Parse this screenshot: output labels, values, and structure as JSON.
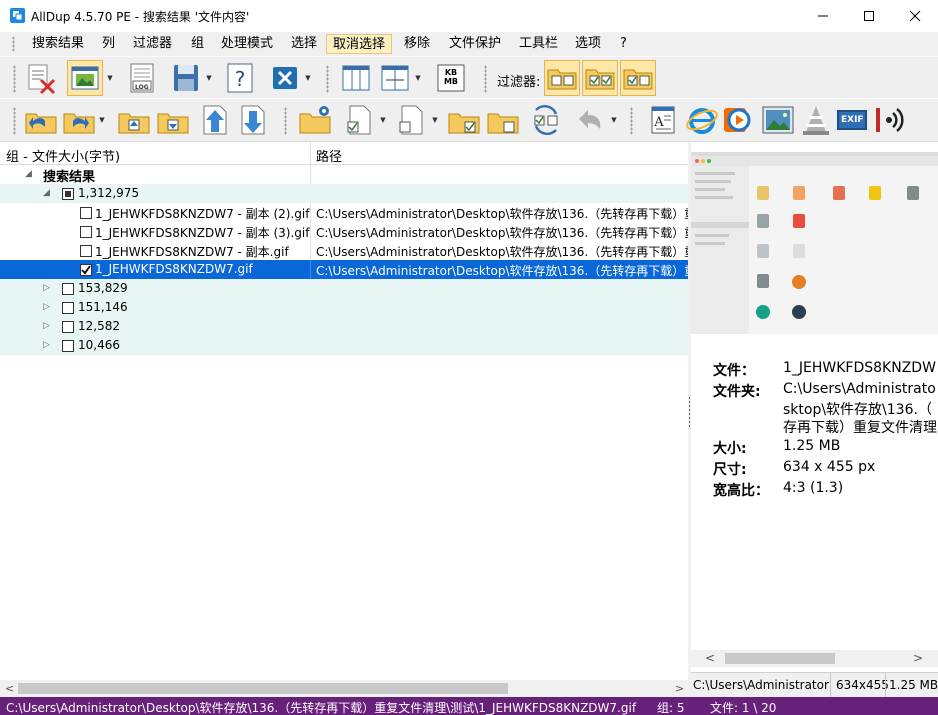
{
  "window": {
    "title": "AllDup 4.5.70 PE - 搜索结果 '文件内容'",
    "accent": "#1e88e5"
  },
  "menu": [
    "搜索结果",
    "列",
    "过滤器",
    "组",
    "处理模式",
    "选择",
    "取消选择",
    "移除",
    "文件保护",
    "工具栏",
    "选项",
    "?"
  ],
  "menu_active": "取消选择",
  "toolbar1": {
    "log_label": "LOG",
    "kbmb_label": "KB MB",
    "filter_label": "过滤器:"
  },
  "toolbar2": {
    "exif_label": "EXIF"
  },
  "columns": {
    "name": "组 - 文件大小(字节)",
    "path": "路径"
  },
  "tree": {
    "root": "搜索结果",
    "expanded_group": "1,312,975",
    "files": [
      {
        "name": "1_JEHWKFDS8KNZDW7 - 副本 (2).gif",
        "path": "C:\\Users\\Administrator\\Desktop\\软件存放\\136.（先转存再下载）重",
        "checked": false,
        "selected": false
      },
      {
        "name": "1_JEHWKFDS8KNZDW7 - 副本 (3).gif",
        "path": "C:\\Users\\Administrator\\Desktop\\软件存放\\136.（先转存再下载）重",
        "checked": false,
        "selected": false
      },
      {
        "name": "1_JEHWKFDS8KNZDW7 - 副本.gif",
        "path": "C:\\Users\\Administrator\\Desktop\\软件存放\\136.（先转存再下载）重",
        "checked": false,
        "selected": false
      },
      {
        "name": "1_JEHWKFDS8KNZDW7.gif",
        "path": "C:\\Users\\Administrator\\Desktop\\软件存放\\136.（先转存再下载）重",
        "checked": true,
        "selected": true
      }
    ],
    "collapsed_groups": [
      "153,829",
      "151,146",
      "12,582",
      "10,466"
    ]
  },
  "preview": {
    "file_label": "文件：",
    "file_value": "1_JEHWKFDS8KNZDW",
    "folder_label": "文件夹:",
    "folder_line1": "C:\\Users\\Administrato",
    "folder_line2": "sktop\\软件存放\\136.（",
    "folder_line3": "存再下载）重复文件清理",
    "size_label": "大小:",
    "size_value": "1.25 MB",
    "dim_label": "尺寸:",
    "dim_value": "634 x 455 px",
    "ratio_label": "宽高比：",
    "ratio_value": "4:3 (1.3)",
    "status_path": "C:\\Users\\Administrator\\",
    "status_dim": "634x455",
    "status_size": "1.25 MB"
  },
  "status": {
    "path": "C:\\Users\\Administrator\\Desktop\\软件存放\\136.（先转存再下载）重复文件清理\\测试\\1_JEHWKFDS8KNZDW7.gif",
    "groups": "组: 5",
    "files": "文件: 1 \\ 20",
    "color": "#68217a"
  }
}
